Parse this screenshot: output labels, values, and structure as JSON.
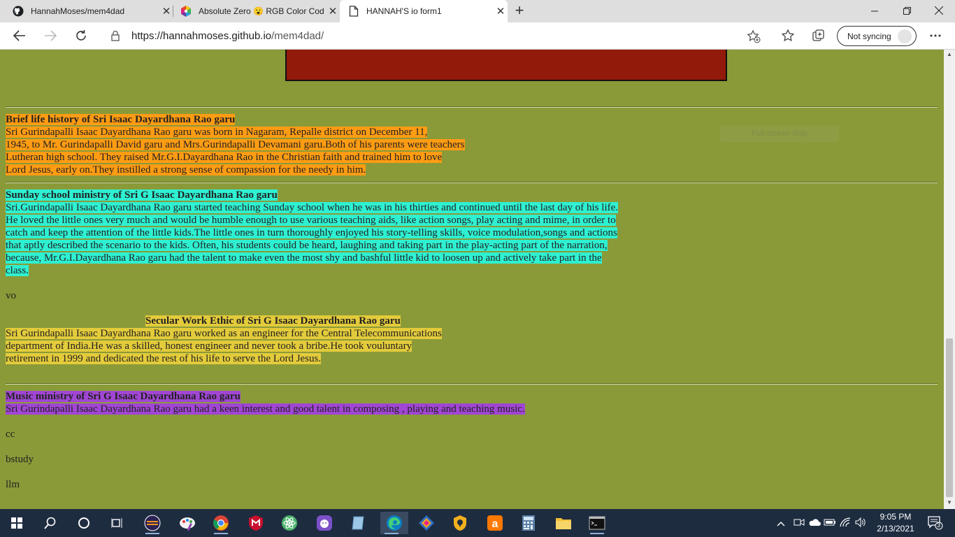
{
  "browser": {
    "tabs": [
      {
        "title": "HannahMoses/mem4dad",
        "icon": "github-icon",
        "active": false
      },
      {
        "title": "Absolute Zero 😮 RGB Color Cod",
        "icon": "rgb-color-icon",
        "active": false
      },
      {
        "title": "HANNAH'S io form1",
        "icon": "page-icon",
        "active": true
      }
    ],
    "url_host": "https://hannahmoses.github.io",
    "url_path": "/mem4dad/",
    "sync_label": "Not syncing",
    "overlay_hint": "Full-screen Snip"
  },
  "page": {
    "section1": {
      "heading": "Brief life history of Sri Isaac Dayardhana Rao garu",
      "lines": [
        "Sri Gurindapalli Isaac Dayardhana Rao garu was born in Nagaram, Repalle district on December 11,",
        "1945, to Mr. Gurindapalli David garu and Mrs.Gurindapalli Devamani garu.Both of his parents were teachers",
        "Lutheran high school. They raised Mr.G.I.Dayardhana Rao in the Christian faith and trained him to love",
        "Lord Jesus, early on.They instilled a strong sense of compassion for the needy in him."
      ],
      "color": "#ff9c13"
    },
    "section2": {
      "heading": "Sunday school ministry of Sri G Isaac Dayardhana Rao garu",
      "lines": [
        "Sri.Gurindapalli Isaac Dayardhana Rao garu started teaching Sunday school when he was in his thirties and continued until the last day of his life.",
        "He loved the little ones very much and would be humble enough to use various teaching aids, like action songs, play acting and mime, in order to",
        "catch and keep the attention of the little kids.The little ones in turn thoroughly enjoyed his story-telling skills, voice modulation,songs and actions",
        "that aptly described the scenario to the kids. Often, his students could be heard, laughing and taking part in the play-acting part of the narration,",
        "because, Mr.G.I.Dayardhana Rao garu had the talent to make even the most shy and bashful little kid to loosen up and actively take part in the",
        "class."
      ],
      "color": "#2ef1d2"
    },
    "text_vo": "vo",
    "section3": {
      "heading": "Secular Work Ethic of Sri G Isaac Dayardhana Rao garu",
      "lines": [
        "Sri Gurindapalli Isaac Dayardhana Rao garu worked as an engineer for the Central Telecommunications",
        "department of India.He was a skilled, honest engineer and never took a bribe.He took vouluntary",
        "retirement in 1999 and dedicated the rest of his life to serve the Lord Jesus."
      ],
      "color": "#e3cb3b"
    },
    "section4": {
      "heading": "Music ministry of Sri G Isaac Dayardhana Rao garu",
      "lines": [
        "Sri Gurindapalli Isaac Dayardhana Rao garu had a keen interest and good talent in composing , playing and teaching music."
      ],
      "color": "#a146d4"
    },
    "text_cc": "cc",
    "text_bstudy": "bstudy",
    "text_llm": "llm",
    "background": "#8a9a38",
    "banner_color": "#921a0a"
  },
  "taskbar": {
    "time": "9:05 PM",
    "date": "2/13/2021",
    "notification_count": "3"
  }
}
